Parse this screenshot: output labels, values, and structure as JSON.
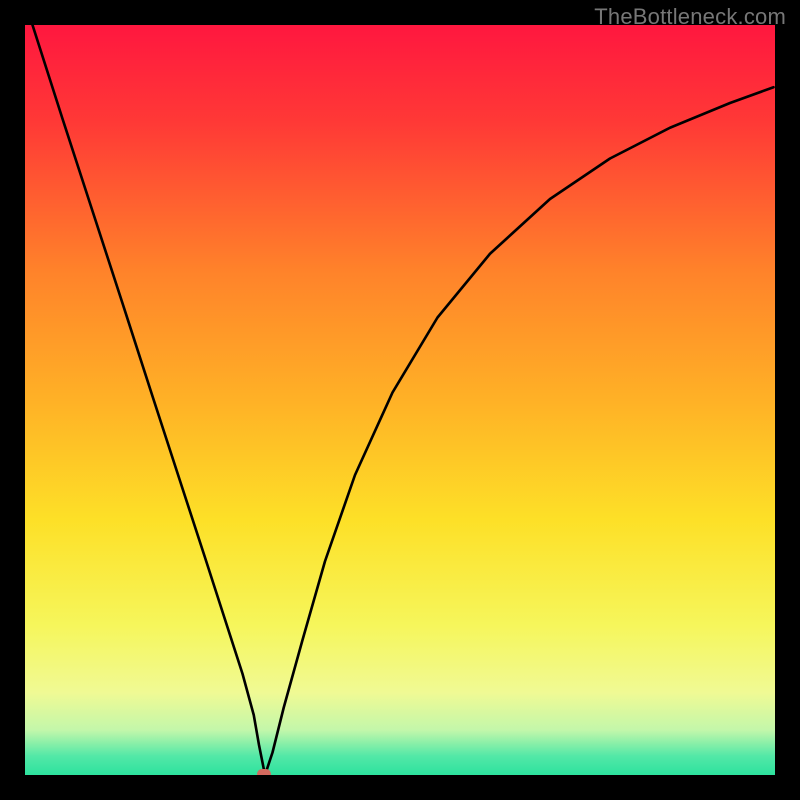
{
  "attribution": "TheBottleneck.com",
  "chart_data": {
    "type": "line",
    "title": "",
    "xlabel": "",
    "ylabel": "",
    "xlim": [
      0,
      1
    ],
    "ylim": [
      0,
      1
    ],
    "background_gradient": {
      "stops": [
        {
          "pos": 0.0,
          "color": "#ff173f"
        },
        {
          "pos": 0.13,
          "color": "#ff3936"
        },
        {
          "pos": 0.33,
          "color": "#ff832a"
        },
        {
          "pos": 0.5,
          "color": "#ffb126"
        },
        {
          "pos": 0.66,
          "color": "#fde027"
        },
        {
          "pos": 0.8,
          "color": "#f6f65b"
        },
        {
          "pos": 0.89,
          "color": "#f0fa94"
        },
        {
          "pos": 0.94,
          "color": "#c3f7aa"
        },
        {
          "pos": 0.975,
          "color": "#52e8a7"
        },
        {
          "pos": 1.0,
          "color": "#2de29e"
        }
      ]
    },
    "series": [
      {
        "name": "bottleneck-curve",
        "color": "#000000",
        "x": [
          0.01,
          0.05,
          0.09,
          0.13,
          0.17,
          0.21,
          0.24,
          0.27,
          0.29,
          0.305,
          0.312,
          0.318,
          0.32,
          0.33,
          0.345,
          0.37,
          0.4,
          0.44,
          0.49,
          0.55,
          0.62,
          0.7,
          0.78,
          0.86,
          0.94,
          0.998
        ],
        "y": [
          1.0,
          0.875,
          0.752,
          0.629,
          0.505,
          0.382,
          0.29,
          0.197,
          0.135,
          0.08,
          0.04,
          0.01,
          0.0,
          0.03,
          0.09,
          0.18,
          0.285,
          0.4,
          0.51,
          0.61,
          0.695,
          0.768,
          0.822,
          0.863,
          0.896,
          0.917
        ]
      }
    ],
    "marker": {
      "x": 0.318,
      "y": 0.002,
      "color": "#d46a5f"
    }
  }
}
